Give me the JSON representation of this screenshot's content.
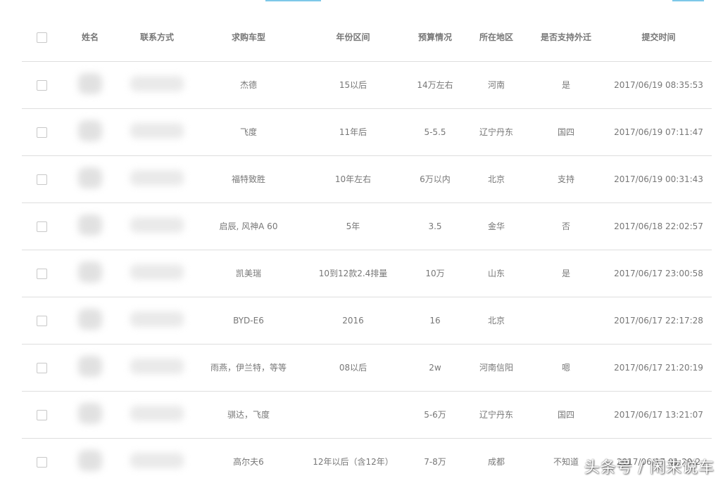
{
  "headers": {
    "name": "姓名",
    "contact": "联系方式",
    "car_model": "求购车型",
    "year_range": "年份区间",
    "budget": "预算情况",
    "region": "所在地区",
    "migration": "是否支持外迁",
    "submit_time": "提交时间"
  },
  "rows": [
    {
      "car": "杰德",
      "year": "15以后",
      "budget": "14万左右",
      "region": "河南",
      "migrate": "是",
      "time": "2017/06/19 08:35:53"
    },
    {
      "car": "飞度",
      "year": "11年后",
      "budget": "5-5.5",
      "region": "辽宁丹东",
      "migrate": "国四",
      "time": "2017/06/19 07:11:47"
    },
    {
      "car": "福特致胜",
      "year": "10年左右",
      "budget": "6万以内",
      "region": "北京",
      "migrate": "支持",
      "time": "2017/06/19 00:31:43"
    },
    {
      "car": "启辰, 风神A 60",
      "year": "5年",
      "budget": "3.5",
      "region": "金华",
      "migrate": "否",
      "time": "2017/06/18 22:02:57"
    },
    {
      "car": "凯美瑞",
      "year": "10到12款2.4排量",
      "budget": "10万",
      "region": "山东",
      "migrate": "是",
      "time": "2017/06/17 23:00:58"
    },
    {
      "car": "BYD-E6",
      "year": "2016",
      "budget": "16",
      "region": "北京",
      "migrate": "",
      "time": "2017/06/17 22:17:28"
    },
    {
      "car": "雨燕，伊兰特，等等",
      "year": "08以后",
      "budget": "2w",
      "region": "河南信阳",
      "migrate": "嗯",
      "time": "2017/06/17 21:20:19"
    },
    {
      "car": "骐达，飞度",
      "year": "",
      "budget": "5-6万",
      "region": "辽宁丹东",
      "migrate": "国四",
      "time": "2017/06/17 13:21:07"
    },
    {
      "car": "高尔夫6",
      "year": "12年以后（含12年）",
      "budget": "7-8万",
      "region": "成都",
      "migrate": "不知道",
      "time": "2017/06/17 01:29:2"
    }
  ],
  "watermark": "头条号 / 闲来说车"
}
